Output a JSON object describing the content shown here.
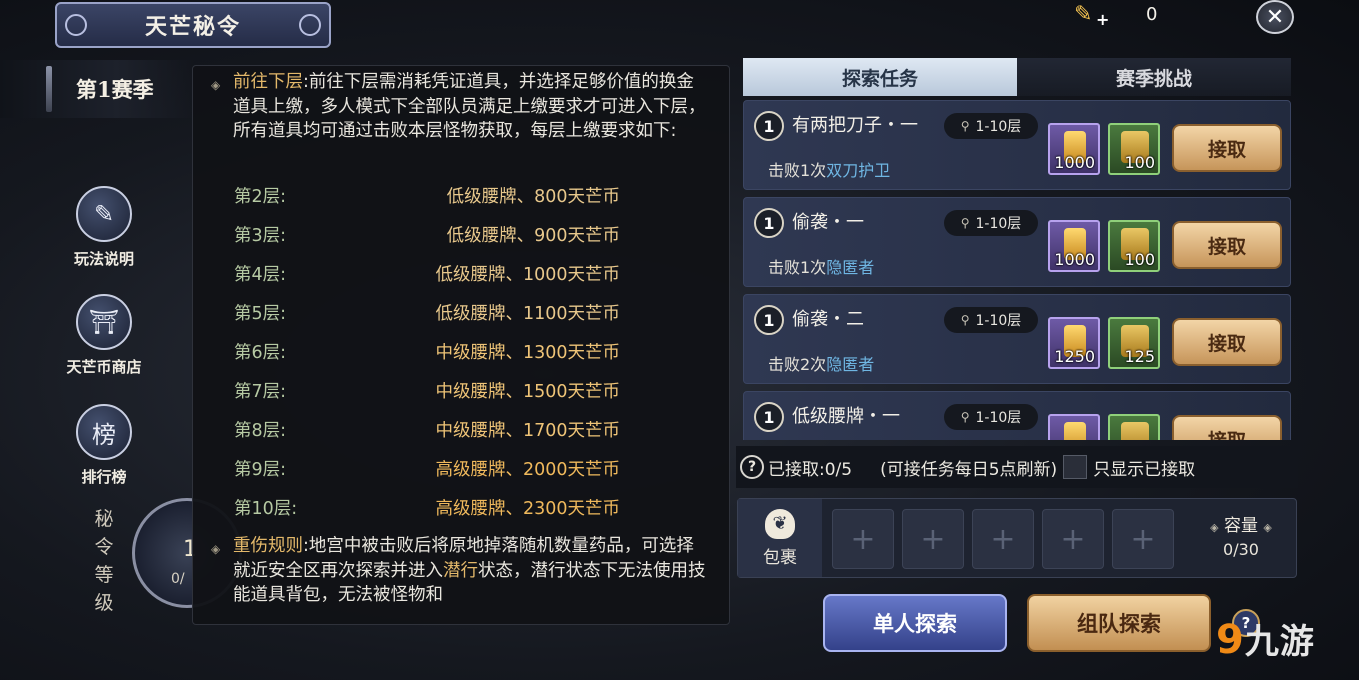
{
  "header": {
    "title": "天芒秘令",
    "season": "第1赛季"
  },
  "currency": {
    "icon": "scroll-token-icon",
    "value": "0"
  },
  "side_menu": [
    {
      "label": "玩法说明",
      "icon": "scroll-icon",
      "glyph": "✎"
    },
    {
      "label": "天芒币商店",
      "icon": "shop-icon",
      "glyph": "⛩"
    },
    {
      "label": "排行榜",
      "icon": "ranking-shield-icon",
      "glyph": "榜"
    }
  ],
  "level": {
    "label": "秘令等级",
    "number": "1",
    "progress": "0/"
  },
  "tooltip": {
    "para1_title": "前往下层",
    "para1_text": ":前往下层需消耗凭证道具，并选择足够价值的换金道具上缴，多人模式下全部队员满足上缴要求才可进入下层，所有道具均可通过击败本层怪物获取，每层上缴要求如下:",
    "floors": [
      {
        "floor": "第2层:",
        "req": "低级腰牌、800天芒币",
        "tier": "low"
      },
      {
        "floor": "第3层:",
        "req": "低级腰牌、900天芒币",
        "tier": "low"
      },
      {
        "floor": "第4层:",
        "req": "低级腰牌、1000天芒币",
        "tier": "low"
      },
      {
        "floor": "第5层:",
        "req": "低级腰牌、1100天芒币",
        "tier": "low"
      },
      {
        "floor": "第6层:",
        "req": "中级腰牌、1300天芒币",
        "tier": "mid"
      },
      {
        "floor": "第7层:",
        "req": "中级腰牌、1500天芒币",
        "tier": "mid"
      },
      {
        "floor": "第8层:",
        "req": "中级腰牌、1700天芒币",
        "tier": "mid"
      },
      {
        "floor": "第9层:",
        "req": "高级腰牌、2000天芒币",
        "tier": "high"
      },
      {
        "floor": "第10层:",
        "req": "高级腰牌、2300天芒币",
        "tier": "high"
      }
    ],
    "para2_title": "重伤规则",
    "para2_text_a": ":地宫中被击败后将原地掉落随机数量药品，可选择就近安全区再次探索并进入",
    "para2_highlight": "潜行",
    "para2_text_b": "状态，潜行状态下无法使用技能道具背包，无法被怪物和"
  },
  "tabs": {
    "explore": "探索任务",
    "season": "赛季挑战"
  },
  "tasks": [
    {
      "num": "1",
      "name": "有两把刀子・一",
      "range": "1-10层",
      "desc_prefix": "击败1次",
      "target": "双刀护卫",
      "reward1": "1000",
      "reward2": "100",
      "button": "接取"
    },
    {
      "num": "1",
      "name": "偷袭・一",
      "range": "1-10层",
      "desc_prefix": "击败1次",
      "target": "隐匿者",
      "reward1": "1000",
      "reward2": "100",
      "button": "接取"
    },
    {
      "num": "1",
      "name": "偷袭・二",
      "range": "1-10层",
      "desc_prefix": "击败2次",
      "target": "隐匿者",
      "reward1": "1250",
      "reward2": "125",
      "button": "接取"
    },
    {
      "num": "1",
      "name": "低级腰牌・一",
      "range": "1-10层",
      "desc_prefix": "",
      "target": "",
      "reward1": "",
      "reward2": "",
      "button": "接取"
    }
  ],
  "status": {
    "help": "?",
    "accepted": "已接取:0/5",
    "note": "(可接任务每日5点刷新)",
    "checkbox_label": "只显示已接取"
  },
  "bag": {
    "label": "包裹",
    "capacity_label": "容量",
    "capacity_value": "0/30",
    "slot_symbol": "+"
  },
  "buttons": {
    "solo": "单人探索",
    "team": "组队探索",
    "help": "?"
  },
  "watermark": {
    "nine": "9",
    "text": "九游"
  },
  "colors": {
    "accent_gold": "#e3b86a",
    "target_blue": "#6fb6e3",
    "tab_active": "#dfe8f3"
  }
}
